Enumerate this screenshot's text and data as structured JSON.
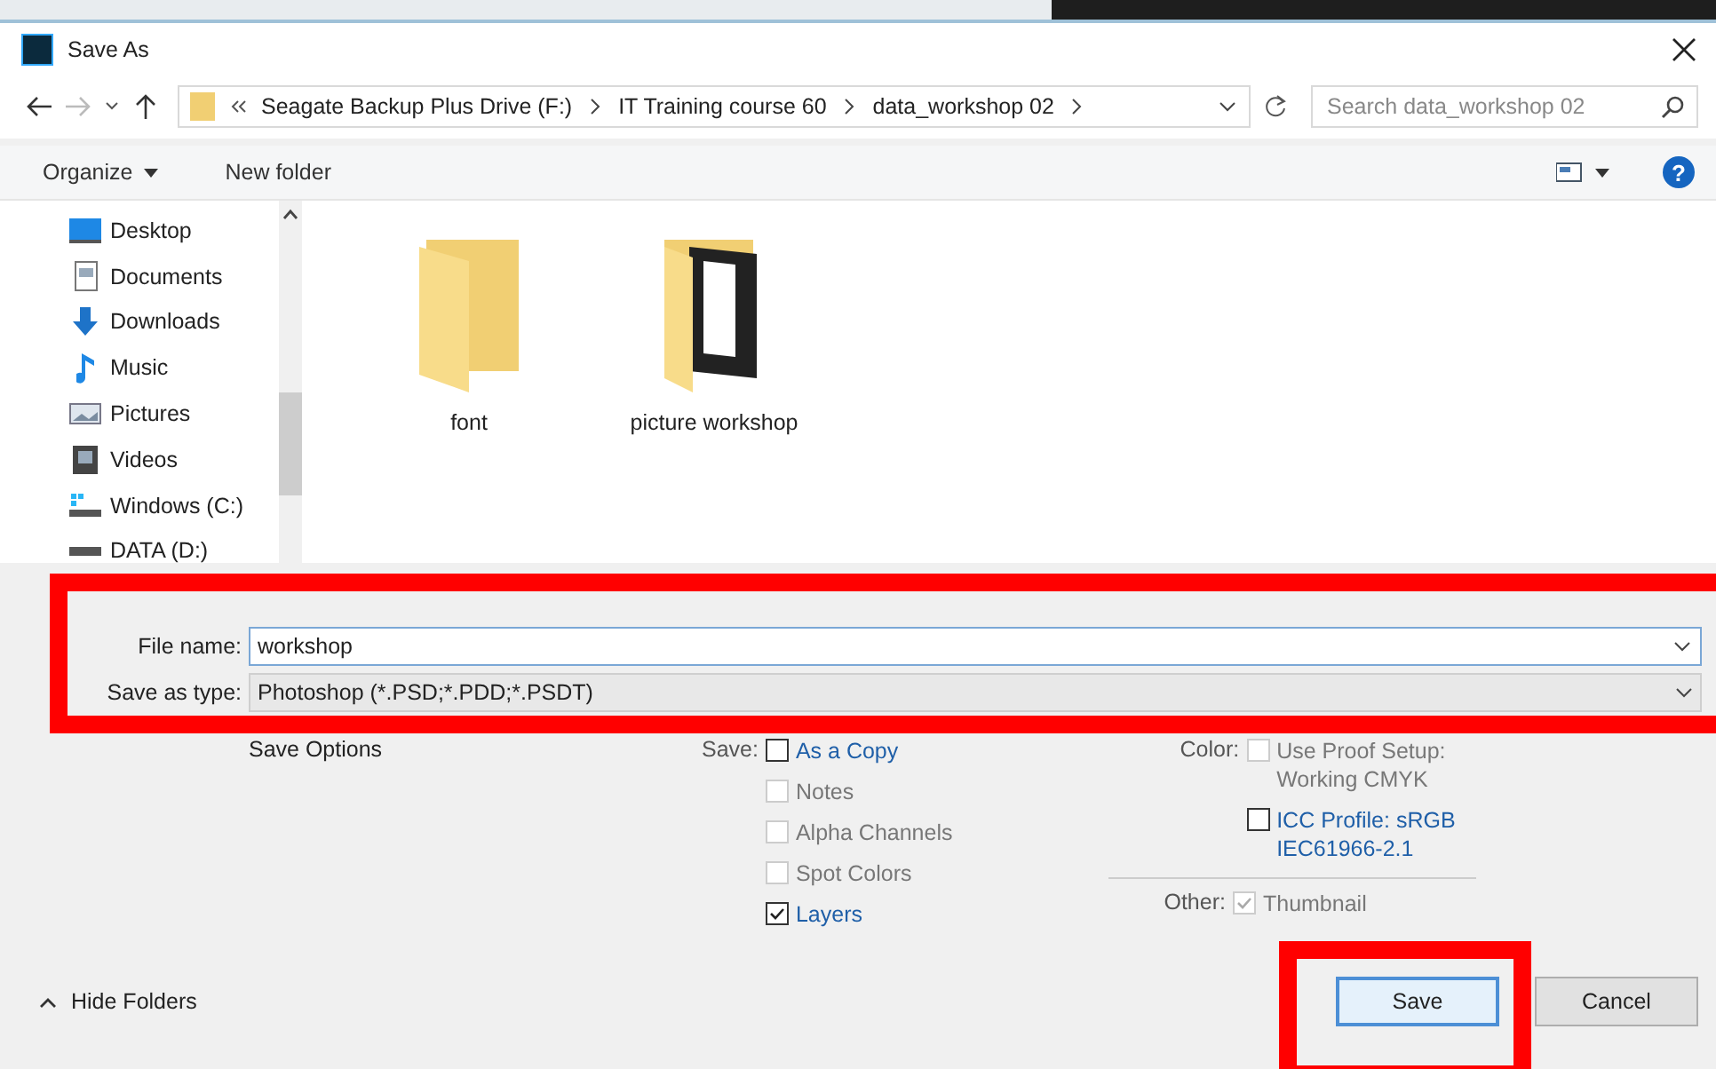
{
  "window": {
    "title": "Save As"
  },
  "address": {
    "path": [
      "Seagate Backup Plus Drive (F:)",
      "IT Training course 60",
      "data_workshop 02"
    ],
    "search_placeholder": "Search data_workshop 02"
  },
  "toolbar": {
    "organize": "Organize",
    "new_folder": "New folder",
    "help": "?"
  },
  "sidebar": {
    "items": [
      {
        "label": "Desktop"
      },
      {
        "label": "Documents"
      },
      {
        "label": "Downloads"
      },
      {
        "label": "Music"
      },
      {
        "label": "Pictures"
      },
      {
        "label": "Videos"
      },
      {
        "label": "Windows (C:)"
      },
      {
        "label": "DATA (D:)"
      }
    ]
  },
  "files": [
    {
      "name": "font",
      "kind": "folder"
    },
    {
      "name": "picture workshop",
      "kind": "photo-folder"
    }
  ],
  "form": {
    "file_name_label": "File name:",
    "file_name": "workshop",
    "type_label": "Save as type:",
    "type": "Photoshop (*.PSD;*.PDD;*.PSDT)"
  },
  "options": {
    "title": "Save Options",
    "save_label": "Save:",
    "save": [
      {
        "label": "As a Copy",
        "checked": false,
        "disabled": false
      },
      {
        "label": "Notes",
        "checked": false,
        "disabled": true
      },
      {
        "label": "Alpha Channels",
        "checked": false,
        "disabled": true
      },
      {
        "label": "Spot Colors",
        "checked": false,
        "disabled": true
      },
      {
        "label": "Layers",
        "checked": true,
        "disabled": false
      }
    ],
    "color_label": "Color:",
    "color": [
      {
        "label": "Use Proof Setup:\nWorking CMYK",
        "checked": false,
        "disabled": true
      },
      {
        "label": "ICC Profile:  sRGB\nIEC61966-2.1",
        "checked": false,
        "disabled": false
      }
    ],
    "other_label": "Other:",
    "other": [
      {
        "label": "Thumbnail",
        "checked": true,
        "disabled": true
      }
    ]
  },
  "footer": {
    "hide_folders": "Hide Folders",
    "save": "Save",
    "cancel": "Cancel"
  }
}
